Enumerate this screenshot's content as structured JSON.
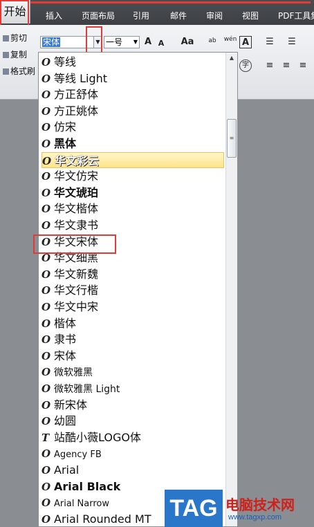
{
  "tabs": [
    "开始",
    "插入",
    "页面布局",
    "引用",
    "邮件",
    "审阅",
    "视图",
    "PDF工具集"
  ],
  "clipboard": {
    "cut": "剪切",
    "copy": "复制",
    "painter": "格式刷"
  },
  "font": {
    "current": "宋体",
    "size": "一号"
  },
  "ribbon": {
    "grow": "A",
    "shrink": "A",
    "change_case": "Aa",
    "clear_format": "ab",
    "phonetic": "wén",
    "border": "A",
    "char_circle": "字"
  },
  "font_list": [
    "等线",
    "等线 Light",
    "方正舒体",
    "方正姚体",
    "仿宋",
    "黑体",
    "华文彩云",
    "华文仿宋",
    "华文琥珀",
    "华文楷体",
    "华文隶书",
    "华文宋体",
    "华文细黑",
    "华文新魏",
    "华文行楷",
    "华文中宋",
    "楷体",
    "隶书",
    "宋体",
    "微软雅黑",
    "微软雅黑 Light",
    "新宋体",
    "幼圆",
    "站酷小薇LOGO体",
    "Agency FB",
    "Arial",
    "Arial Black",
    "Arial Narrow",
    "Arial Rounded MT"
  ],
  "highlighted_index": 6,
  "selected_index": 11,
  "watermark": {
    "tag": "TAG",
    "title": "电脑技术网",
    "url": "www.tagxp.com"
  }
}
